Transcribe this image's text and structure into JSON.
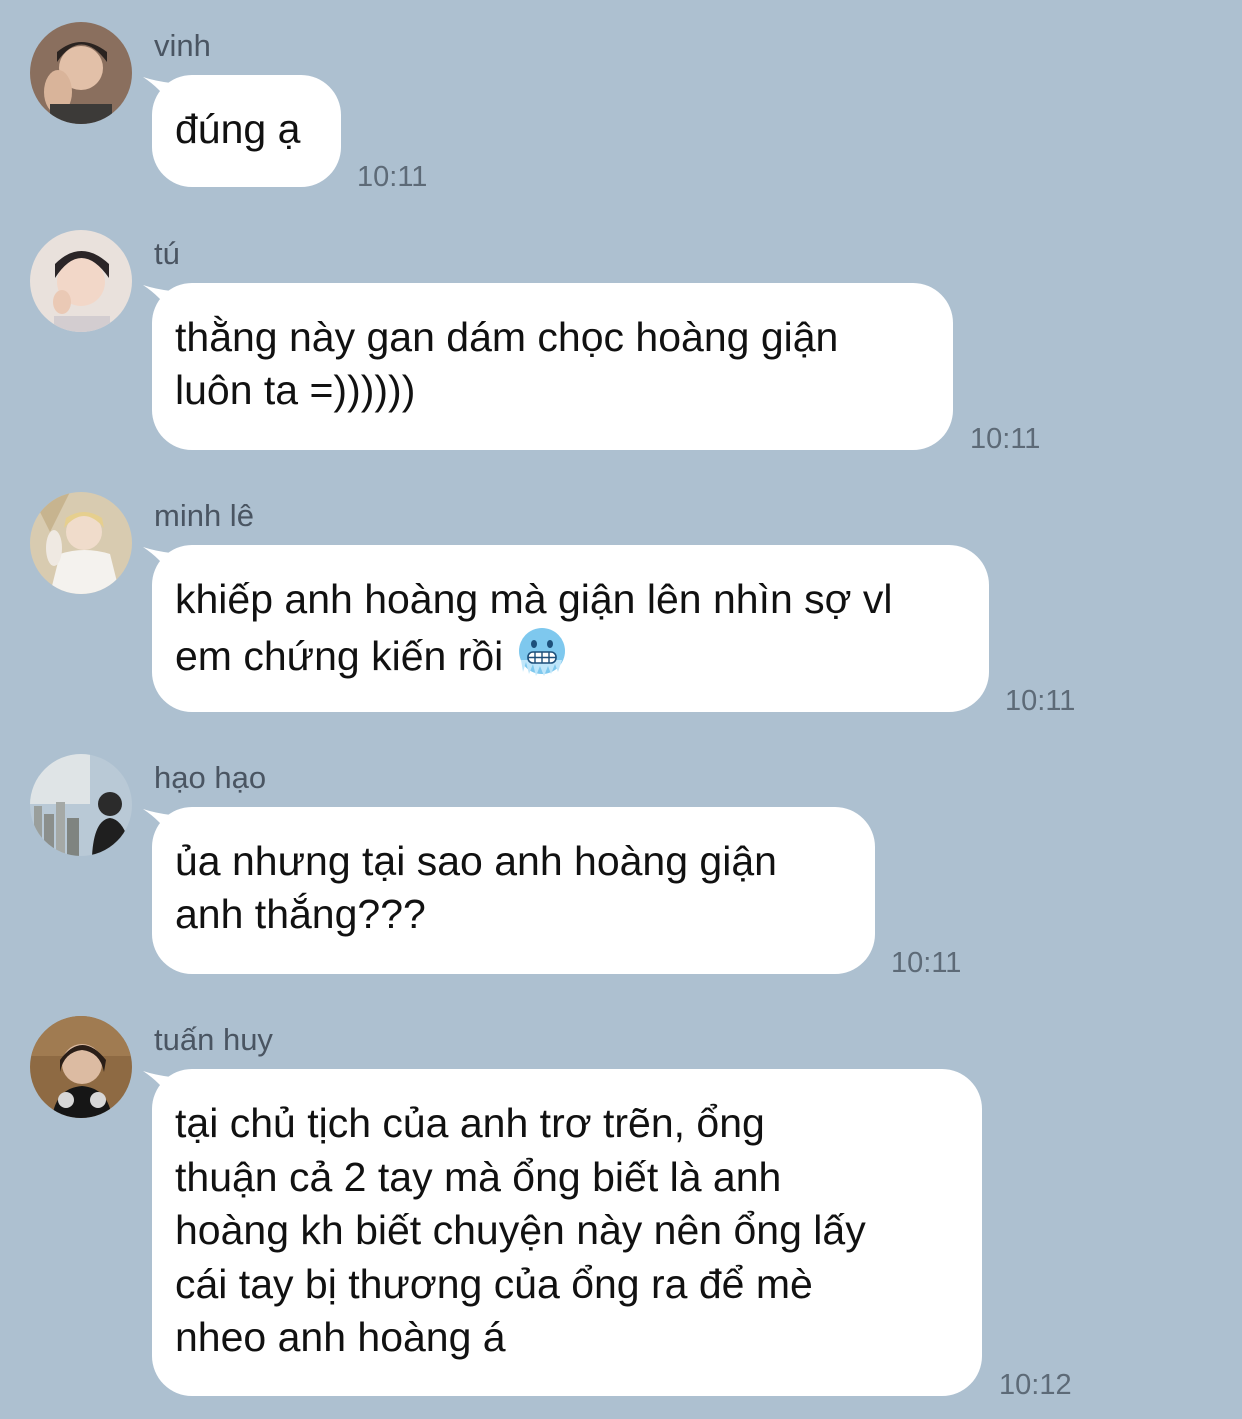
{
  "messages": [
    {
      "sender": "vinh",
      "lines": [
        "đúng ạ"
      ],
      "time": "10:11"
    },
    {
      "sender": "tú",
      "lines": [
        "thằng này gan dám chọc hoàng giận",
        "luôn ta =))))))"
      ],
      "time": "10:11"
    },
    {
      "sender": "minh lê",
      "lines": [
        "khiếp anh hoàng mà giận lên nhìn sợ vl",
        "em chứng kiến rồi"
      ],
      "emoji": "freezing-face",
      "time": "10:11"
    },
    {
      "sender": "hạo hạo",
      "lines": [
        "ủa nhưng tại sao anh hoàng giận",
        "anh thắng???"
      ],
      "time": "10:11"
    },
    {
      "sender": "tuấn huy",
      "lines": [
        "tại chủ tịch của anh trơ trẽn, ổng",
        "thuận cả 2 tay mà ổng biết là anh",
        "hoàng kh biết chuyện này nên ổng lấy",
        "cái tay bị thương của ổng ra để mè",
        "nheo anh hoàng á"
      ],
      "time": "10:12"
    }
  ],
  "colors": {
    "background": "#adc0d0",
    "bubble": "#ffffff",
    "emoji": "#7ec8ee"
  }
}
